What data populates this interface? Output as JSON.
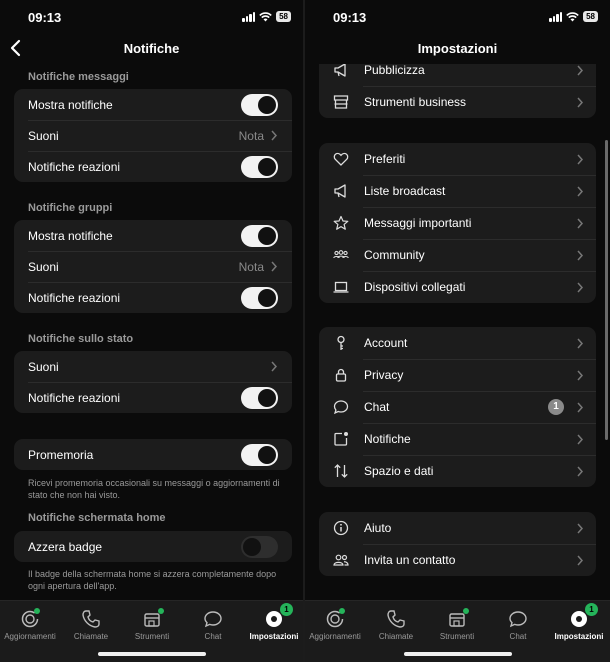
{
  "left": {
    "time": "09:13",
    "battery": "58",
    "title": "Notifiche",
    "sections": [
      {
        "title": "Notifiche messaggi",
        "rows": [
          {
            "label": "Mostra notifiche",
            "type": "toggle",
            "on": true
          },
          {
            "label": "Suoni",
            "type": "value",
            "value": "Nota"
          },
          {
            "label": "Notifiche reazioni",
            "type": "toggle",
            "on": true
          }
        ]
      },
      {
        "title": "Notifiche gruppi",
        "rows": [
          {
            "label": "Mostra notifiche",
            "type": "toggle",
            "on": true
          },
          {
            "label": "Suoni",
            "type": "value",
            "value": "Nota"
          },
          {
            "label": "Notifiche reazioni",
            "type": "toggle",
            "on": true
          }
        ]
      },
      {
        "title": "Notifiche sullo stato",
        "rows": [
          {
            "label": "Suoni",
            "type": "value",
            "value": ""
          },
          {
            "label": "Notifiche reazioni",
            "type": "toggle",
            "on": true
          }
        ]
      }
    ],
    "promemoria": {
      "label": "Promemoria",
      "on": true,
      "footnote": "Ricevi promemoria occasionali su messaggi o aggiornamenti di stato che non hai visto."
    },
    "home_section_title": "Notifiche schermata home",
    "azzera": {
      "label": "Azzera badge",
      "on": false,
      "footnote": "Il badge della schermata home si azzera completamente dopo ogni apertura dell'app."
    }
  },
  "right": {
    "time": "09:13",
    "battery": "58",
    "title": "Impostazioni",
    "groups": [
      [
        {
          "label": "Pubblicizza",
          "icon": "megaphone-icon"
        },
        {
          "label": "Strumenti business",
          "icon": "store-icon"
        }
      ],
      [
        {
          "label": "Preferiti",
          "icon": "heart-icon"
        },
        {
          "label": "Liste broadcast",
          "icon": "megaphone-icon"
        },
        {
          "label": "Messaggi importanti",
          "icon": "star-icon"
        },
        {
          "label": "Community",
          "icon": "community-icon"
        },
        {
          "label": "Dispositivi collegati",
          "icon": "laptop-icon"
        }
      ],
      [
        {
          "label": "Account",
          "icon": "key-icon"
        },
        {
          "label": "Privacy",
          "icon": "lock-icon"
        },
        {
          "label": "Chat",
          "icon": "chat-bubble-icon",
          "badge": "1"
        },
        {
          "label": "Notifiche",
          "icon": "notification-icon"
        },
        {
          "label": "Spazio e dati",
          "icon": "arrows-updown-icon"
        }
      ],
      [
        {
          "label": "Aiuto",
          "icon": "info-icon"
        },
        {
          "label": "Invita un contatto",
          "icon": "people-icon"
        }
      ]
    ]
  },
  "tabs": [
    {
      "label": "Aggiornamenti",
      "icon": "updates-icon"
    },
    {
      "label": "Chiamate",
      "icon": "phone-icon"
    },
    {
      "label": "Strumenti",
      "icon": "tools-icon"
    },
    {
      "label": "Chat",
      "icon": "chat-icon"
    },
    {
      "label": "Impostazioni",
      "icon": "settings-icon",
      "badge": "1",
      "active": true
    }
  ],
  "colors": {
    "accent": "#25b45a",
    "background": "#0b0b0b",
    "card": "#1c1c1c"
  }
}
